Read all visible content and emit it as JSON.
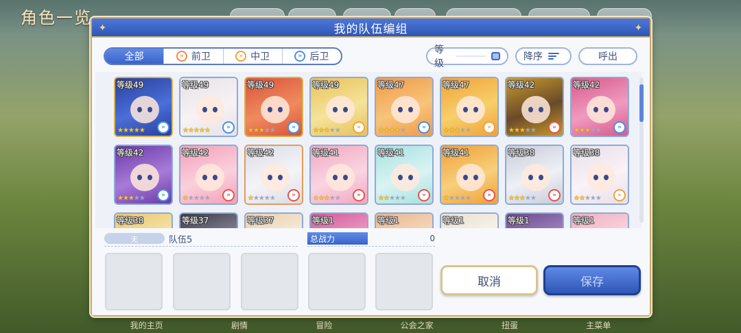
{
  "background": {
    "title": "角色一览",
    "bottom_nav": [
      "我的主页",
      "剧情",
      "冒险",
      "公会之家",
      "扭蛋",
      "主菜单"
    ]
  },
  "dialog": {
    "title": "我的队伍编组",
    "filters": [
      "全部",
      "前卫",
      "中卫",
      "后卫"
    ],
    "active_filter": "全部",
    "sort_label": "等级",
    "order_label": "降序",
    "call_label": "呼出"
  },
  "characters": [
    {
      "level": "等级49",
      "stars": 5,
      "role": "rear",
      "frame": "gold"
    },
    {
      "level": "等级49",
      "stars": 5,
      "role": "rear",
      "frame": "blue"
    },
    {
      "level": "等级49",
      "stars": 3,
      "role": "rear",
      "frame": "gold"
    },
    {
      "level": "等级49",
      "stars": 3,
      "role": "mid",
      "frame": "blue"
    },
    {
      "level": "等级47",
      "stars": 4,
      "role": "rear",
      "frame": "blue"
    },
    {
      "level": "等级47",
      "stars": 3,
      "role": "mid",
      "frame": "blue"
    },
    {
      "level": "等级42",
      "stars": 3,
      "role": "front",
      "frame": "blue"
    },
    {
      "level": "等级42",
      "stars": 3,
      "role": "rear",
      "frame": "blue"
    },
    {
      "level": "等级42",
      "stars": 3,
      "role": "rear",
      "frame": "blue"
    },
    {
      "level": "等级42",
      "stars": 1,
      "role": "front",
      "frame": "blue"
    },
    {
      "level": "等级42",
      "stars": 1,
      "role": "front",
      "frame": "orange"
    },
    {
      "level": "等级41",
      "stars": 3,
      "role": "front",
      "frame": "blue"
    },
    {
      "level": "等级41",
      "stars": 2,
      "role": "front",
      "frame": "blue"
    },
    {
      "level": "等级41",
      "stars": 1,
      "role": "front",
      "frame": "blue"
    },
    {
      "level": "等级38",
      "stars": 3,
      "role": "front",
      "frame": "blue"
    },
    {
      "level": "等级38",
      "stars": 2,
      "role": "mid",
      "frame": "blue"
    },
    {
      "level": "等级38",
      "stars": 0,
      "role": "",
      "frame": "blue"
    },
    {
      "level": "等级37",
      "stars": 0,
      "role": "",
      "frame": "blue"
    },
    {
      "level": "等级37",
      "stars": 0,
      "role": "",
      "frame": "blue"
    },
    {
      "level": "等级1",
      "stars": 0,
      "role": "",
      "frame": "blue"
    },
    {
      "level": "等级1",
      "stars": 0,
      "role": "",
      "frame": "blue"
    },
    {
      "level": "等级1",
      "stars": 0,
      "role": "",
      "frame": "blue"
    },
    {
      "level": "等级1",
      "stars": 0,
      "role": "",
      "frame": "blue"
    },
    {
      "level": "等级1",
      "stars": 0,
      "role": "",
      "frame": "blue"
    }
  ],
  "team": {
    "tag": "无",
    "name": "队伍5",
    "power_label": "总战力",
    "power_value": "0",
    "slot_count": 5
  },
  "buttons": {
    "cancel": "取消",
    "save": "保存"
  },
  "colors": {
    "accent": "#3a64c8",
    "gold": "#d9b24d",
    "front": "#e8524a",
    "mid": "#f0a23a",
    "rear": "#4a8ee0"
  }
}
